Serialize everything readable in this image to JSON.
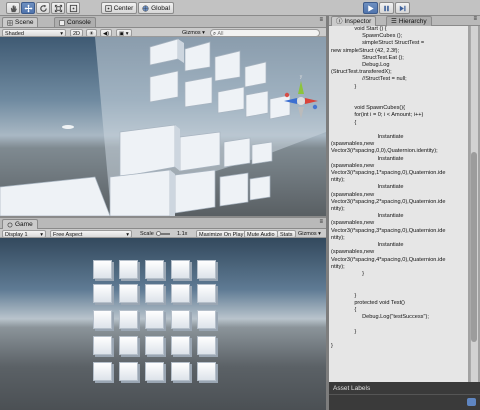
{
  "toolbar": {
    "pivot_label": "Center",
    "space_label": "Global"
  },
  "scene": {
    "tab_label": "Scene",
    "console_tab_label": "Console",
    "shading_mode": "Shaded",
    "twod_label": "2D",
    "gizmos_label": "Gizmos",
    "search_placeholder": "All"
  },
  "game": {
    "tab_label": "Game",
    "display": "Display 1",
    "aspect": "Free Aspect",
    "scale_label": "Scale",
    "scale_value": "1.1x",
    "maximize_label": "Maximize On Play",
    "mute_label": "Mute Audio",
    "stats_label": "Stats",
    "gizmos_label": "Gizmos"
  },
  "inspector": {
    "tab_label": "Inspector",
    "hierarchy_tab_label": "Hierarchy",
    "code": "               void Start () {\n                    SpawnCubes ();\n                    simpleStruct StructTest =\nnew simpleStruct (42, 2.3f);\n                    StructTest.Eat ();\n                    Debug.Log\n(StructTest.transferedX);\n                    //StructTest = null;\n               }\n\n\n               void SpawnCubes(){\n               for(int i = 0; i < Amount; i++)\n               {\n\n                              Instantiate\n(spawnables,new\nVector3(i*spacing,0,0),Quaternion.identity);\n                              Instantiate\n(spawnables,new\nVector3(i*spacing,1*spacing,0),Quaternion.ide\nntity);\n                              Instantiate\n(spawnables,new\nVector3(i*spacing,2*spacing,0),Quaternion.ide\nntity);\n                              Instantiate\n(spawnables,new\nVector3(i*spacing,3*spacing,0),Quaternion.ide\nntity);\n                              Instantiate\n(spawnables,new\nVector3(i*spacing,4*spacing,0),Quaternion.ide\nntity);\n                    }\n\n\n               }\n               protected void Test()\n               {\n                    Debug.Log(\"testSuccess\");\n\n               }\n\n}"
  },
  "asset_labels": {
    "label": "Asset Labels"
  },
  "colors": {
    "play_active": "#4f74ad",
    "gizmo_x": "#d9433a",
    "gizmo_y": "#8cc43c",
    "gizmo_z": "#3c6fd1"
  }
}
